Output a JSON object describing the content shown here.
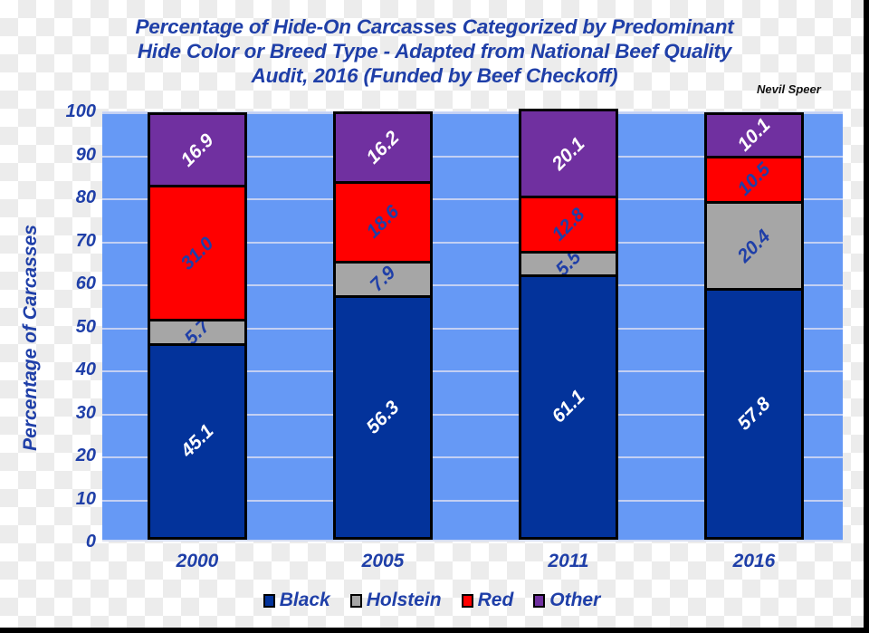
{
  "chart_data": {
    "type": "bar",
    "subtype": "stacked-column",
    "title": "Percentage of Hide-On Carcasses Categorized by Predominant Hide Color or Breed Type - Adapted from National Beef Quality Audit, 2016 (Funded by Beef Checkoff)",
    "title_lines": [
      "Percentage of Hide-On Carcasses Categorized by Predominant",
      "Hide Color or Breed Type - Adapted from National Beef Quality",
      "Audit, 2016 (Funded by Beef Checkoff)"
    ],
    "credit": "Nevil Speer",
    "xlabel": "",
    "ylabel": "Percentage of Carcasses",
    "categories": [
      "2000",
      "2005",
      "2011",
      "2016"
    ],
    "ylim": [
      0,
      100
    ],
    "yticks": [
      "0",
      "10",
      "20",
      "30",
      "40",
      "50",
      "60",
      "70",
      "80",
      "90",
      "100"
    ],
    "grid": true,
    "legend_position": "bottom",
    "series": [
      {
        "name": "Black",
        "color": "#03339B",
        "label_color": "white",
        "values": [
          45.1,
          56.3,
          61.1,
          57.8
        ],
        "labels": [
          "45.1",
          "56.3",
          "61.1",
          "57.8"
        ]
      },
      {
        "name": "Holstein",
        "color": "#A6A6A6",
        "label_color": "blue",
        "values": [
          5.7,
          7.9,
          5.5,
          20.4
        ],
        "labels": [
          "5.7",
          "7.9",
          "5.5",
          "20.4"
        ]
      },
      {
        "name": "Red",
        "color": "#FF0000",
        "label_color": "blue",
        "values": [
          31.0,
          18.6,
          12.8,
          10.5
        ],
        "labels": [
          "31.0",
          "18.6",
          "12.8",
          "10.5"
        ]
      },
      {
        "name": "Other",
        "color": "#7030A0",
        "label_color": "white",
        "values": [
          16.9,
          16.2,
          20.1,
          10.1
        ],
        "labels": [
          "16.9",
          "16.2",
          "20.1",
          "10.1"
        ]
      }
    ],
    "colors": {
      "plot_background": "#6699F5",
      "gridline": "#c3d0f3",
      "text_blue": "#1F3FA8",
      "bar_outline": "#000000"
    }
  }
}
